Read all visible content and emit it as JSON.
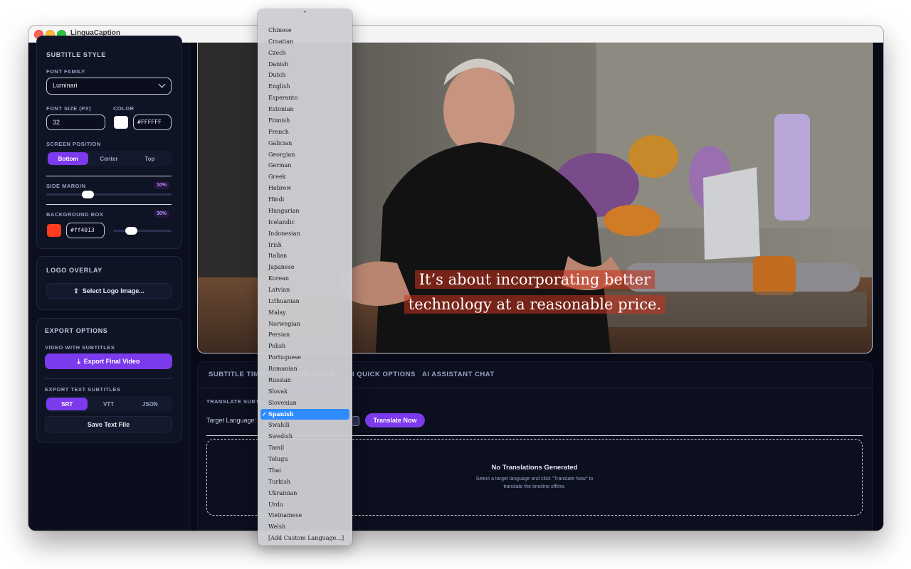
{
  "app": {
    "title": "LinguaCaption"
  },
  "sidebar": {
    "subtitle_style": {
      "title": "SUBTITLE STYLE",
      "font_family_label": "FONT FAMILY",
      "font_family_value": "Luminari",
      "font_size_label": "FONT SIZE (PX)",
      "font_size_value": "32",
      "color_label": "COLOR",
      "color_hex": "#FFFFFF",
      "screen_position_label": "SCREEN POSITION",
      "positions": [
        "Bottom",
        "Center",
        "Top"
      ],
      "active_position": "Bottom",
      "side_margin_label": "SIDE MARGIN",
      "side_margin_value": "10%",
      "side_margin_level": 0.33,
      "background_box_label": "BACKGROUND BOX",
      "background_box_value": "30%",
      "background_box_level": 0.3,
      "background_color_hex": "#ff4013",
      "background_color": "#ff3b1f"
    },
    "logo_overlay": {
      "title": "LOGO OVERLAY",
      "select_button": "Select Logo Image..."
    },
    "export_options": {
      "title": "EXPORT OPTIONS",
      "video_label": "VIDEO WITH SUBTITLES",
      "export_video_button": "Export Final Video",
      "text_label": "EXPORT TEXT SUBTITLES",
      "formats": [
        "SRT",
        "VTT",
        "JSON"
      ],
      "active_format": "SRT",
      "save_text_button": "Save Text File"
    }
  },
  "video": {
    "subtitle_lines": [
      "It’s about incorporating better",
      "technology at a reasonable price."
    ]
  },
  "panel": {
    "tabs": [
      "SUBTITLE TIMELINE",
      "TRANSLATION",
      "AI QUICK OPTIONS",
      "AI ASSISTANT CHAT"
    ],
    "visible_tabs": [
      "SUBTITLE TIME",
      "I QUICK OPTIONS",
      "AI ASSISTANT CHAT"
    ],
    "active_tab": "TRANSLATION",
    "translate_section_label": "TRANSLATE SUBTI",
    "target_language_label": "Target Language:",
    "translate_button": "Translate Now",
    "empty_title": "No Translations Generated",
    "empty_desc": "Select a target language and click \"Translate Now\" to translate the timeline offline."
  },
  "dropdown": {
    "selected": "Spanish",
    "options": [
      "Chinese",
      "Croatian",
      "Czech",
      "Danish",
      "Dutch",
      "English",
      "Esperanto",
      "Estonian",
      "Finnish",
      "French",
      "Galician",
      "Georgian",
      "German",
      "Greek",
      "Hebrew",
      "Hindi",
      "Hungarian",
      "Icelandic",
      "Indonesian",
      "Irish",
      "Italian",
      "Japanese",
      "Korean",
      "Latvian",
      "Lithuanian",
      "Malay",
      "Norwegian",
      "Persian",
      "Polish",
      "Portuguese",
      "Romanian",
      "Russian",
      "Slovak",
      "Slovenian",
      "Spanish",
      "Swahili",
      "Swedish",
      "Tamil",
      "Telugu",
      "Thai",
      "Turkish",
      "Ukrainian",
      "Urdu",
      "Vietnamese",
      "Welsh",
      "[Add Custom Language...]"
    ]
  },
  "colors": {
    "accent": "#7c3aed",
    "selection": "#2f8cff"
  }
}
